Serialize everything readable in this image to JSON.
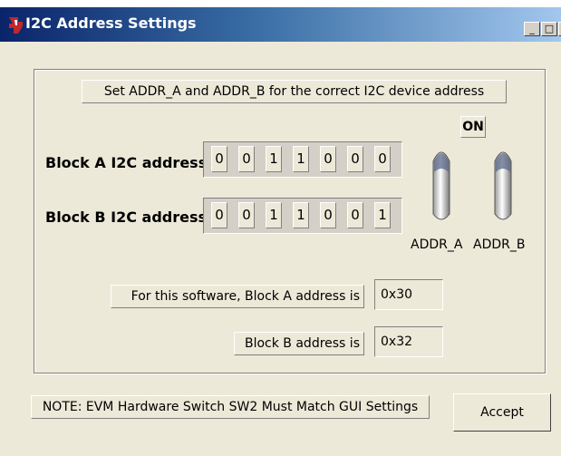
{
  "window": {
    "title": "I2C Address Settings",
    "minimize_label": "_",
    "maximize_label": "□",
    "close_label": "X"
  },
  "instructions": "Set ADDR_A and ADDR_B for the correct I2C device address",
  "on_label": "ON",
  "block_a": {
    "label": "Block A I2C address",
    "bits": [
      "0",
      "0",
      "1",
      "1",
      "0",
      "0",
      "0"
    ]
  },
  "block_b": {
    "label": "Block B I2C address",
    "bits": [
      "0",
      "0",
      "1",
      "1",
      "0",
      "0",
      "1"
    ]
  },
  "switches": {
    "addr_a_label": "ADDR_A",
    "addr_b_label": "ADDR_B"
  },
  "result_a": {
    "label": "For this software,  Block A address is",
    "value": "0x30"
  },
  "result_b": {
    "label": "Block B address is",
    "value": "0x32"
  },
  "note": "NOTE: EVM Hardware Switch SW2 Must Match GUI Settings",
  "accept_label": "Accept"
}
